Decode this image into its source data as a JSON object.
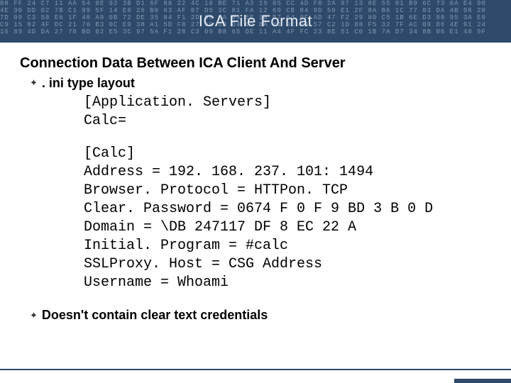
{
  "header": {
    "title": "ICA File Format",
    "hex_bg": "08 FF 24 C7 11 AA 54 0E 92 3B D1 6F 88 22 4C 10 BE 71 A3 19 05 CC 4D F0 2A 97 13 8E 55 01 B9 6C 73 0A E4 90\n4E 30 DD 02 7B C1 99 5F 14 E8 26 B0 63 AF 07 D5 3C 81 FA 12 69 CB 04 9D 50 E1 2F 8A B6 1C 77 03 DA 4B 96 20\n7D 09 C3 58 E6 1F 40 A9 0B 72 DE 35 84 F1 2D 06 CA 93 5E 18 B7 64 0F AD 47 F2 29 80 C5 1B 6E D3 08 95 3A E0\nC9 15 82 4F DC 21 76 B3 0C E9 38 A1 5D F8 27 90 6B D4 03 BA 41 9E 0A 57 C2 1D 88 F5 32 7F AC 09 D6 4E 91 24\n16 89 4D DA 27 70 BD 02 E5 3C 97 5A F1 28 C3 09 B8 65 DE 11 A4 4F FC 23 8E 51 C0 1B 7A D7 34 8B 06 E1 48 9F"
  },
  "heading": "Connection Data Between ICA Client And Server",
  "bullet1": ". ini type layout",
  "ini_block1": "[Application. Servers]\nCalc=",
  "ini_block2": "[Calc]\nAddress = 192. 168. 237. 101: 1494\nBrowser. Protocol = HTTPon. TCP\nClear. Password = 0674 F 0 F 9 BD 3 B 0 D\nDomain = \\DB 247117 DF 8 EC 22 A\nInitial. Program = #calc\nSSLProxy. Host = CSG Address\nUsername = Whoami",
  "bullet2": "Doesn't contain clear text credentials"
}
